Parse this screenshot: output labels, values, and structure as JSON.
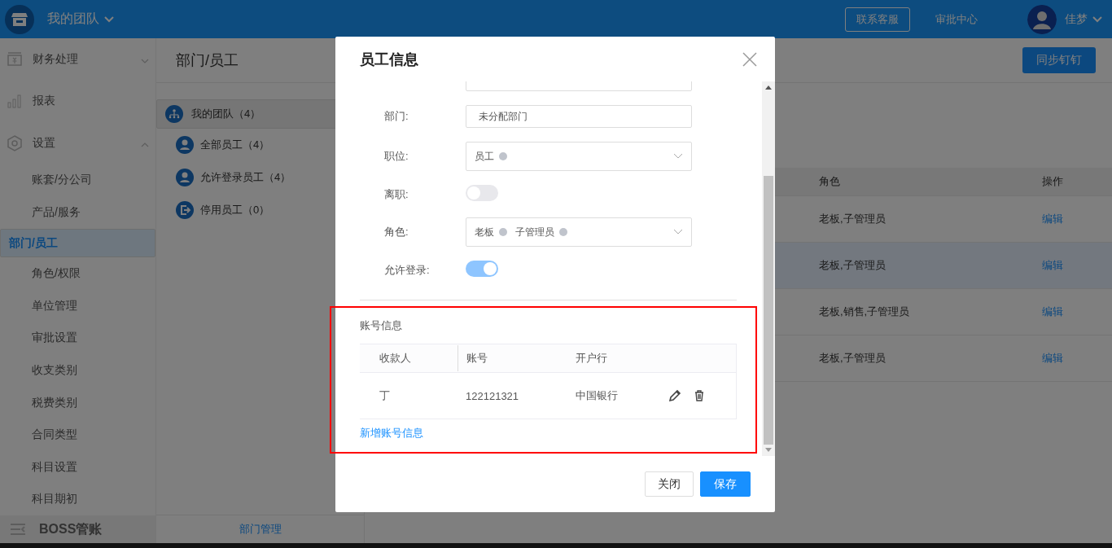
{
  "header": {
    "team": "我的团队",
    "buttons": [
      {
        "label": "联系客服",
        "kind": "outlined"
      },
      {
        "label": "审批中心",
        "kind": "text"
      }
    ],
    "user": "佳梦"
  },
  "sidebar": {
    "items": [
      {
        "label": "财务处理",
        "kind": "money",
        "expanded": false
      },
      {
        "label": "报表",
        "kind": "chart"
      },
      {
        "label": "设置",
        "kind": "gear",
        "expanded": true,
        "children": [
          {
            "label": "账套/分公司",
            "selected": false
          },
          {
            "label": "产品/服务",
            "selected": false
          },
          {
            "label": "部门/员工",
            "selected": true
          },
          {
            "label": "角色/权限",
            "selected": false
          },
          {
            "label": "单位管理",
            "selected": false
          },
          {
            "label": "审批设置",
            "selected": false
          },
          {
            "label": "收支类别",
            "selected": false
          },
          {
            "label": "税费类别",
            "selected": false
          },
          {
            "label": "合同类型",
            "selected": false
          },
          {
            "label": "科目设置",
            "selected": false
          },
          {
            "label": "科目期初",
            "selected": false
          }
        ]
      }
    ],
    "footer": "BOSS管账"
  },
  "page": {
    "title": "部门/员工",
    "sync_button": "同步钉钉"
  },
  "tree": {
    "items": [
      {
        "label": "我的团队（4）",
        "kind": "org",
        "selected": true
      },
      {
        "label": "全部员工（4）",
        "kind": "user",
        "selected": false
      },
      {
        "label": "允许登录员工（4）",
        "kind": "user",
        "selected": false
      },
      {
        "label": "停用员工（0）",
        "kind": "exit",
        "selected": false
      }
    ],
    "footer": "部门管理"
  },
  "table": {
    "columns": [
      "角色",
      "操作"
    ],
    "rows": [
      {
        "role": "老板,子管理员",
        "action": "编辑",
        "highlighted": false
      },
      {
        "role": "老板,子管理员",
        "action": "编辑",
        "highlighted": true
      },
      {
        "role": "老板,销售,子管理员",
        "action": "编辑",
        "highlighted": false
      },
      {
        "role": "老板,子管理员",
        "action": "编辑",
        "highlighted": false
      }
    ]
  },
  "dialog": {
    "title": "员工信息",
    "fields": [
      {
        "label": "部门:",
        "kind": "input",
        "value": "未分配部门"
      },
      {
        "label": "职位:",
        "kind": "select",
        "tags": [
          "员工"
        ]
      },
      {
        "label": "离职:",
        "kind": "switch",
        "on": false
      },
      {
        "label": "角色:",
        "kind": "select",
        "tags": [
          "老板",
          "子管理员"
        ]
      },
      {
        "label": "允许登录:",
        "kind": "switch",
        "on": true
      }
    ],
    "account": {
      "title": "账号信息",
      "columns": [
        "收款人",
        "账号",
        "开户行"
      ],
      "rows": [
        {
          "cells": [
            "丁",
            "122121321",
            "中国银行"
          ]
        }
      ],
      "add_link": "新增账号信息"
    },
    "buttons": [
      {
        "label": "关闭",
        "kind": "default"
      },
      {
        "label": "保存",
        "kind": "primary"
      }
    ]
  }
}
